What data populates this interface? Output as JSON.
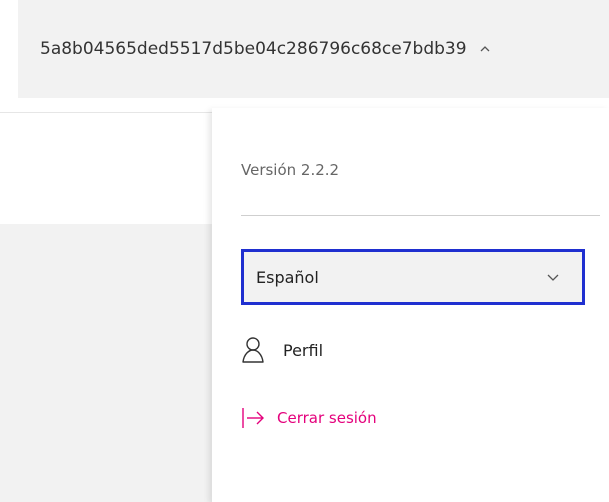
{
  "account": {
    "id": "5a8b04565ded5517d5be04c286796c68ce7bdb39",
    "caret_icon": "chevron-up-icon"
  },
  "menu": {
    "version": "Versión 2.2.2",
    "language": {
      "selected": "Español",
      "icon": "chevron-down-icon"
    },
    "items": [
      {
        "label": "Perfil",
        "icon": "user-icon"
      },
      {
        "label": "Cerrar sesión",
        "icon": "logout-arrow-icon"
      }
    ]
  },
  "colors": {
    "focus_border": "#1f2fd0",
    "logout_accent": "#e4007c",
    "panel_grey": "#f2f2f2"
  }
}
